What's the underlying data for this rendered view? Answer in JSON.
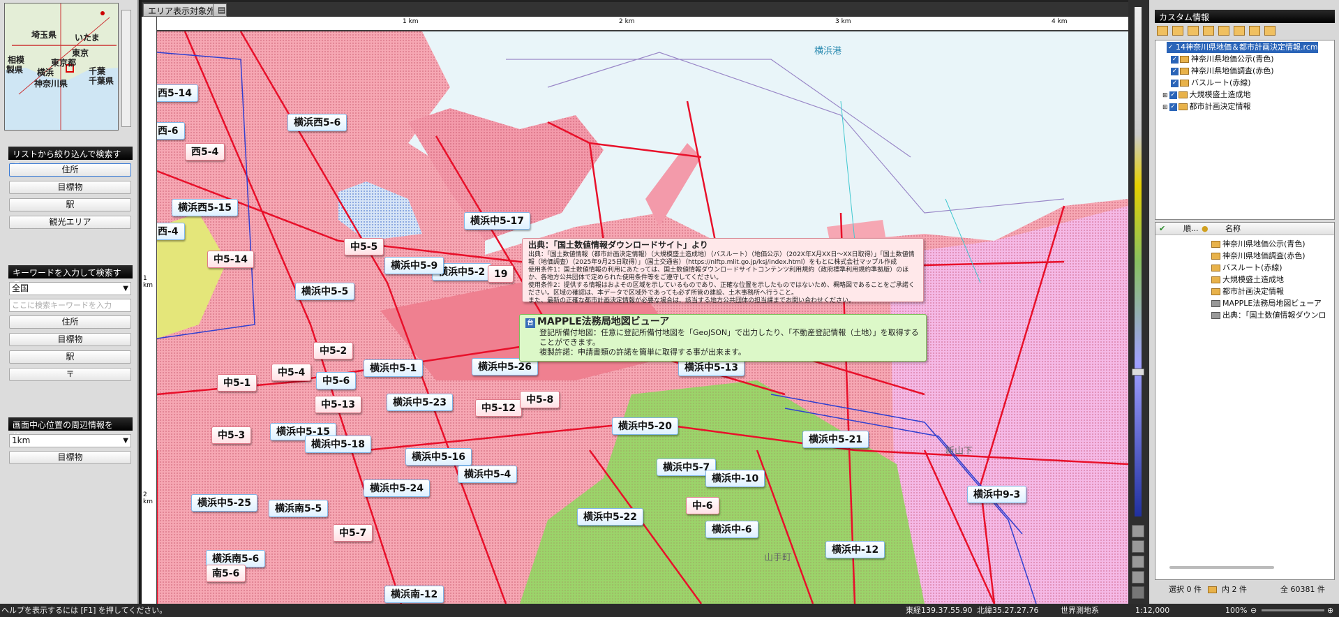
{
  "left_panel": {
    "minimap_labels": [
      "埼玉県",
      "いたま",
      "東京都",
      "東京",
      "千葉県",
      "千葉",
      "神奈川県",
      "横浜",
      "相模",
      "製県"
    ],
    "filter_list": {
      "header": "リストから絞り込んで検索する",
      "buttons": [
        "住所",
        "目標物",
        "駅",
        "観光エリア"
      ]
    },
    "keyword": {
      "header": "キーワードを入力して検索する",
      "scope_value": "全国",
      "input_placeholder": "ここに検索キーワードを入力",
      "buttons": [
        "住所",
        "目標物",
        "駅",
        "〒"
      ]
    },
    "nearby": {
      "header": "画面中心位置の周辺情報を検...",
      "range_value": "1km",
      "button": "目標物"
    }
  },
  "map_window": {
    "tab_label": "エリア表示対象外",
    "ruler_top": [
      "1 km",
      "2 km",
      "3 km",
      "4 km"
    ],
    "ruler_left": [
      "1 km",
      "2 km"
    ],
    "place_labels": [
      "横浜港",
      "新山下",
      "山手町"
    ],
    "pins_blue": [
      "横浜西5-6",
      "横浜西5-15",
      "横浜中5-17",
      "横浜中5-5",
      "横浜中5-2",
      "横浜中5-9",
      "横浜中5-1",
      "横浜中5-23",
      "横浜中5-26",
      "横浜中5-13",
      "横浜中5-20",
      "横浜中5-21",
      "横浜中5-15",
      "横浜中5-18",
      "横浜中5-16",
      "横浜中5-4",
      "横浜中5-24",
      "横浜中5-25",
      "横浜南5-5",
      "横浜中5-7",
      "横浜中-10",
      "横浜中5-22",
      "横浜中-6",
      "横浜中9-3",
      "横浜中-12",
      "横浜南5-6",
      "横浜南-12"
    ],
    "pins_red": [
      "西5-4",
      "中5-14",
      "中5-5",
      "中5-2",
      "中5-1",
      "中5-4",
      "中5-13",
      "中5-12",
      "中5-8",
      "中5-3",
      "中5-7",
      "中-6",
      "南5-6"
    ],
    "pins_plain": [
      "西5-14",
      "西-6",
      "西-4",
      "中5-6",
      "19"
    ],
    "info_source": {
      "title": "出典：「国土数値情報ダウンロードサイト」より",
      "lines": [
        "出典：「国土数値情報（都市計画決定情報）（大規模盛土造成地）（バスルート）（地価公示）（202X年X月XX日～XX日取得）」「国土数値情報（地価調査）（2025年9月25日取得）」（国土交通省）（https://nlftp.mlit.go.jp/ksj/index.html）をもとに株式会社マップル作成",
        "使用条件1：国土数値情報の利用にあたっては、国土数値情報ダウンロードサイトコンテンツ利用規約（政府標準利用規約準拠版）のほか、各地方公共団体で定められた使用条件等をご遵守してください。",
        "使用条件2：提供する情報はおよその区域を示しているものであり、正確な位置を示したものではないため、概略図であることをご承諾ください。区域の確認は、本データで区域外であっても必ず所管の建設、土木事務所へ行うこと。",
        "また、最新の正確な都市計画決定情報が必要な場合は、該当する地方公共団体の担当課までお問い合わせください。"
      ]
    },
    "info_viewer": {
      "title": "MAPPLE法務局地図ビューア",
      "lines": [
        "登記所備付地図：任意に登記所備付地図を「GeoJSON」で出力したり、「不動産登記情報（土地）」を取得することができます。",
        "複製許諾：申請書類の許諾を簡単に取得する事が出来ます。"
      ]
    }
  },
  "right_panel": {
    "header": "カスタム情報",
    "tree": [
      "14神奈川県地価＆都市計画決定情報.rcm",
      "神奈川県地価公示(青色)",
      "神奈川県地価調査(赤色)",
      "バスルート(赤線)",
      "大規模盛土造成地",
      "都市計画決定情報"
    ],
    "list_columns": [
      "順...",
      "名称"
    ],
    "list_items": [
      "神奈川県地価公示(青色)",
      "神奈川県地価調査(赤色)",
      "バスルート(赤線)",
      "大規模盛土造成地",
      "都市計画決定情報",
      "MAPPLE法務局地図ビューア",
      "出典：「国土数値情報ダウンロ"
    ],
    "status": {
      "selected": "選択 0 件",
      "inner": "内 2 件",
      "total": "全 60381 件"
    }
  },
  "statusbar": {
    "help": "ヘルプを表示するには [F1] を押してください。",
    "longitude": "東経139.37.55.90",
    "latitude": "北緯35.27.27.76",
    "datum": "世界測地系",
    "scale": "1:12,000",
    "zoom": "100%"
  },
  "colors": {
    "map_water": "#e9f5f9",
    "zone_pink": "#f6a7b3",
    "zone_red": "#ef8090",
    "route_red": "#e8102a",
    "park_green": "#9bd46a",
    "panel_header": "#000000"
  }
}
